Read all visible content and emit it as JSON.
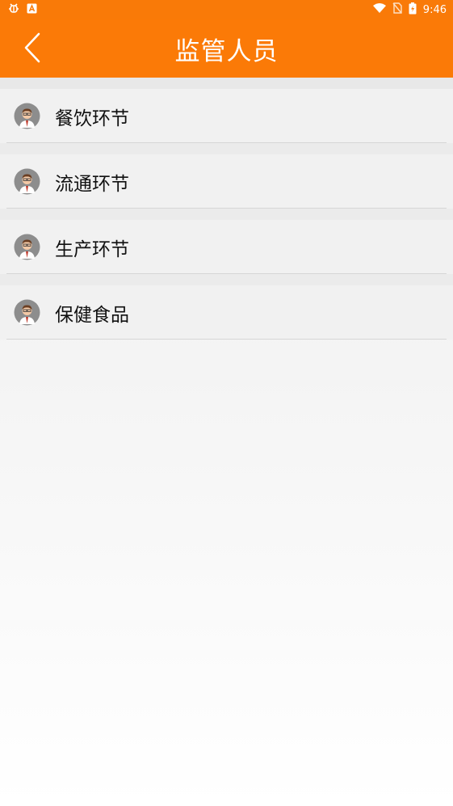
{
  "status_bar": {
    "time": "9:46",
    "left_icons": [
      "bug-icon",
      "a-notification-icon"
    ],
    "right_icons": [
      "wifi-icon",
      "no-sim-icon",
      "battery-charging-icon"
    ]
  },
  "header": {
    "title": "监管人员",
    "back_icon": "chevron-left-icon",
    "background": "#fb7a07"
  },
  "list": {
    "items": [
      {
        "label": "餐饮环节",
        "icon": "person-avatar-icon"
      },
      {
        "label": "流通环节",
        "icon": "person-avatar-icon"
      },
      {
        "label": "生产环节",
        "icon": "person-avatar-icon"
      },
      {
        "label": "保健食品",
        "icon": "person-avatar-icon"
      }
    ]
  }
}
